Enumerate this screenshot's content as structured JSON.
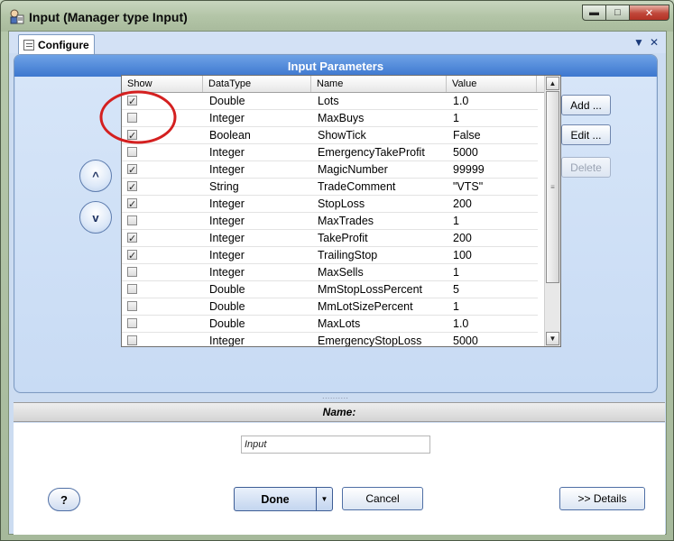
{
  "window": {
    "title": "Input (Manager type Input)",
    "minimize_glyph": "▬",
    "maximize_glyph": "□",
    "close_glyph": "✕"
  },
  "tab": {
    "label": "Configure",
    "pin_glyph": "▼",
    "close_glyph": "✕"
  },
  "panel": {
    "title": "Input Parameters",
    "up_label": "^",
    "down_label": "v"
  },
  "grid": {
    "columns": [
      "Show",
      "DataType",
      "Name",
      "Value"
    ],
    "rows": [
      {
        "show": true,
        "type": "Double",
        "name": "Lots",
        "value": "1.0"
      },
      {
        "show": false,
        "type": "Integer",
        "name": "MaxBuys",
        "value": "1"
      },
      {
        "show": true,
        "type": "Boolean",
        "name": "ShowTick",
        "value": "False"
      },
      {
        "show": false,
        "type": "Integer",
        "name": "EmergencyTakeProfit",
        "value": "5000"
      },
      {
        "show": true,
        "type": "Integer",
        "name": "MagicNumber",
        "value": "99999"
      },
      {
        "show": true,
        "type": "String",
        "name": "TradeComment",
        "value": "\"VTS\""
      },
      {
        "show": true,
        "type": "Integer",
        "name": "StopLoss",
        "value": "200"
      },
      {
        "show": false,
        "type": "Integer",
        "name": "MaxTrades",
        "value": "1"
      },
      {
        "show": true,
        "type": "Integer",
        "name": "TakeProfit",
        "value": "200"
      },
      {
        "show": true,
        "type": "Integer",
        "name": "TrailingStop",
        "value": "100"
      },
      {
        "show": false,
        "type": "Integer",
        "name": "MaxSells",
        "value": "1"
      },
      {
        "show": false,
        "type": "Double",
        "name": "MmStopLossPercent",
        "value": "5"
      },
      {
        "show": false,
        "type": "Double",
        "name": "MmLotSizePercent",
        "value": "1"
      },
      {
        "show": false,
        "type": "Double",
        "name": "MaxLots",
        "value": "1.0"
      },
      {
        "show": false,
        "type": "Integer",
        "name": "EmergencyStopLoss",
        "value": "5000"
      }
    ]
  },
  "side_buttons": {
    "add": "Add ...",
    "edit": "Edit ...",
    "delete": "Delete"
  },
  "name_section": {
    "label": "Name:",
    "value": "Input"
  },
  "footer": {
    "help": "?",
    "done": "Done",
    "cancel": "Cancel",
    "details": ">> Details"
  },
  "colors": {
    "panel_header": "#3d77cf",
    "annotation_circle": "#d42020"
  }
}
